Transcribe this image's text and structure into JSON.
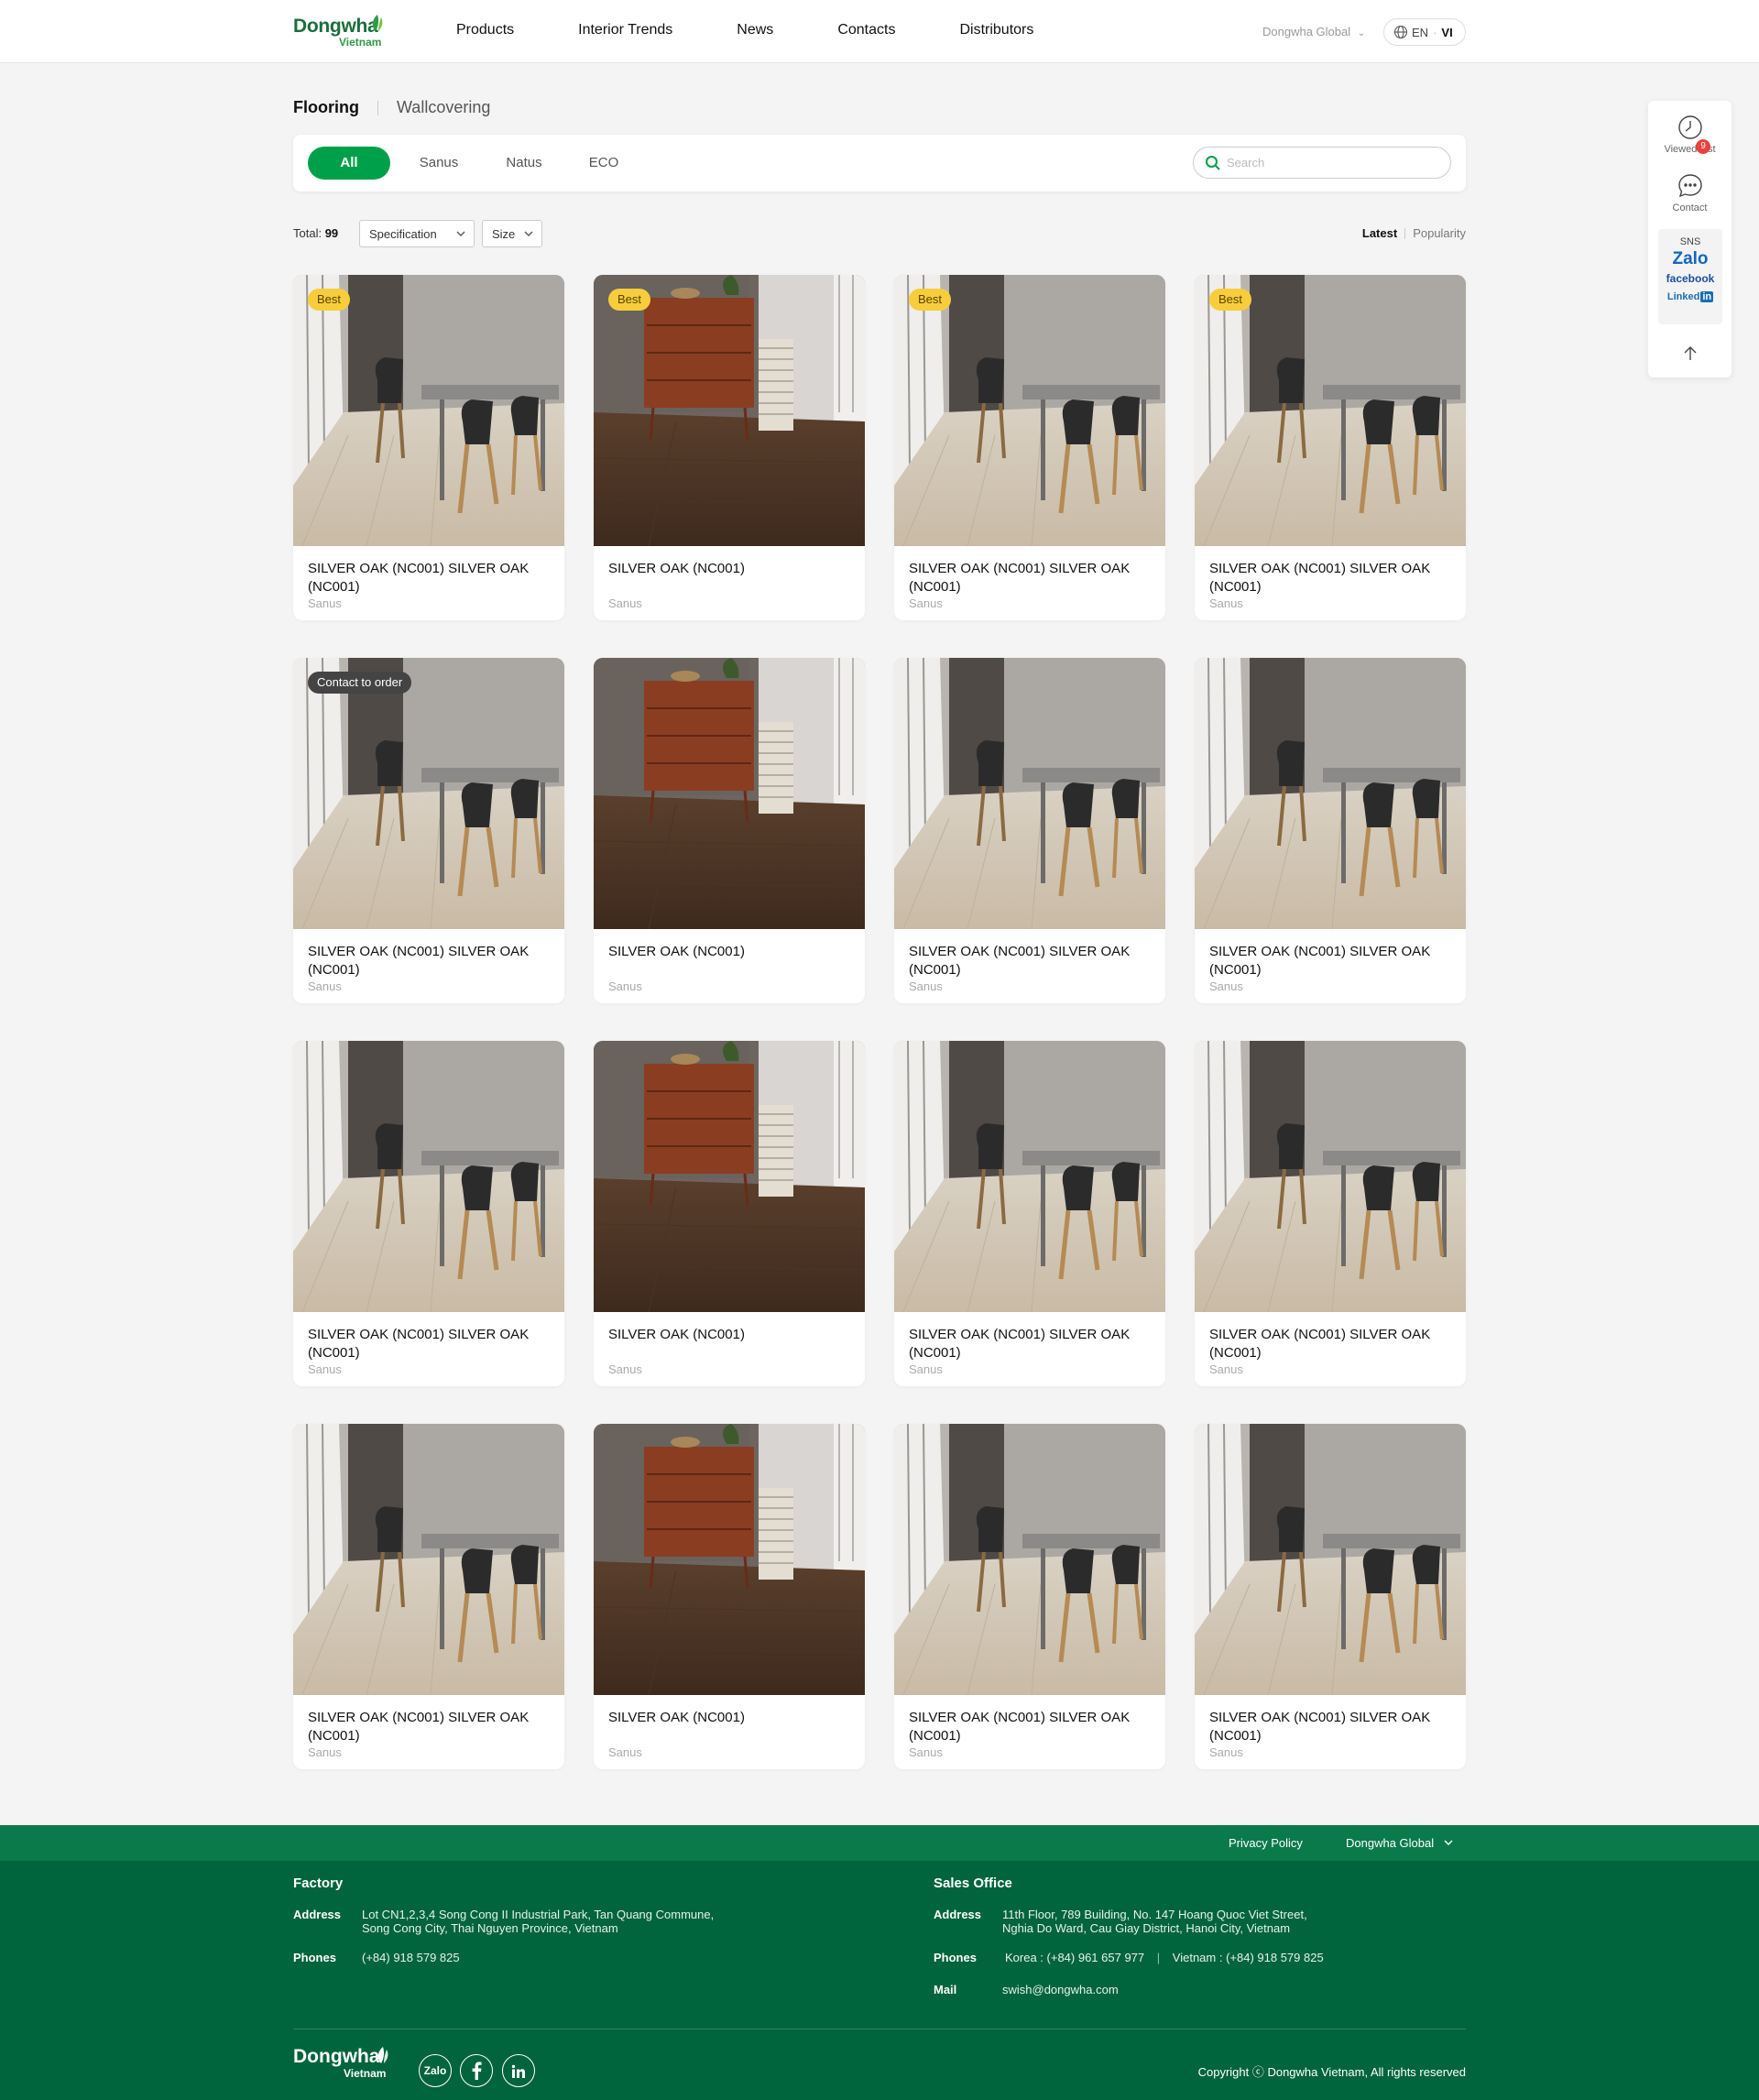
{
  "header": {
    "logo_word": "Dongwha",
    "logo_sub": "Vietnam",
    "nav": [
      "Products",
      "Interior Trends",
      "News",
      "Contacts",
      "Distributors"
    ],
    "global_label": "Dongwha Global",
    "lang_en": "EN",
    "lang_vi": "VI"
  },
  "category_tabs": {
    "active": "Flooring",
    "inactive": "Wallcovering"
  },
  "filters": {
    "pills": [
      "All",
      "Sanus",
      "Natus",
      "ECO"
    ],
    "search_placeholder": "Search"
  },
  "toolbar": {
    "total_label": "Total:",
    "total_count": "99",
    "spec_label": "Specification",
    "size_label": "Size",
    "sort_latest": "Latest",
    "sort_popularity": "Popularity"
  },
  "products": [
    {
      "name": "SILVER OAK (NC001) SILVER OAK (NC001)",
      "series": "Sanus",
      "badge": "Best",
      "badge_type": "best",
      "image": "dining"
    },
    {
      "name": "SILVER OAK (NC001)",
      "series": "Sanus",
      "badge": "Best",
      "badge_type": "best",
      "image": "cabinet"
    },
    {
      "name": "SILVER OAK (NC001) SILVER OAK (NC001)",
      "series": "Sanus",
      "badge": "Best",
      "badge_type": "best",
      "image": "dining"
    },
    {
      "name": "SILVER OAK (NC001) SILVER OAK (NC001)",
      "series": "Sanus",
      "badge": "Best",
      "badge_type": "best",
      "image": "dining"
    },
    {
      "name": "SILVER OAK (NC001) SILVER OAK (NC001)",
      "series": "Sanus",
      "badge": "Contact to order",
      "badge_type": "contact",
      "image": "dining"
    },
    {
      "name": "SILVER OAK (NC001)",
      "series": "Sanus",
      "badge": "",
      "badge_type": "",
      "image": "cabinet"
    },
    {
      "name": "SILVER OAK (NC001) SILVER OAK (NC001)",
      "series": "Sanus",
      "badge": "",
      "badge_type": "",
      "image": "dining"
    },
    {
      "name": "SILVER OAK (NC001) SILVER OAK (NC001)",
      "series": "Sanus",
      "badge": "",
      "badge_type": "",
      "image": "dining"
    },
    {
      "name": "SILVER OAK (NC001) SILVER OAK (NC001)",
      "series": "Sanus",
      "badge": "",
      "badge_type": "",
      "image": "dining"
    },
    {
      "name": "SILVER OAK (NC001)",
      "series": "Sanus",
      "badge": "",
      "badge_type": "",
      "image": "cabinet"
    },
    {
      "name": "SILVER OAK (NC001) SILVER OAK (NC001)",
      "series": "Sanus",
      "badge": "",
      "badge_type": "",
      "image": "dining"
    },
    {
      "name": "SILVER OAK (NC001) SILVER OAK (NC001)",
      "series": "Sanus",
      "badge": "",
      "badge_type": "",
      "image": "dining"
    },
    {
      "name": "SILVER OAK (NC001) SILVER OAK (NC001)",
      "series": "Sanus",
      "badge": "",
      "badge_type": "",
      "image": "dining"
    },
    {
      "name": "SILVER OAK (NC001)",
      "series": "Sanus",
      "badge": "",
      "badge_type": "",
      "image": "cabinet"
    },
    {
      "name": "SILVER OAK (NC001) SILVER OAK (NC001)",
      "series": "Sanus",
      "badge": "",
      "badge_type": "",
      "image": "dining"
    },
    {
      "name": "SILVER OAK (NC001) SILVER OAK (NC001)",
      "series": "Sanus",
      "badge": "",
      "badge_type": "",
      "image": "dining"
    }
  ],
  "side_widget": {
    "viewed_label": "Viewed List",
    "viewed_count": "9",
    "contact_label": "Contact",
    "sns_label": "SNS",
    "zalo": "Zalo",
    "facebook": "facebook",
    "linkedin": "Linked",
    "linkedin_in": "in"
  },
  "footer": {
    "privacy": "Privacy Policy",
    "global": "Dongwha Global",
    "factory_title": "Factory",
    "factory_address_label": "Address",
    "factory_address_1": "Lot CN1,2,3,4 Song Cong II Industrial Park, Tan Quang Commune,",
    "factory_address_2": "Song Cong City, Thai Nguyen Province, Vietnam",
    "factory_phones_label": "Phones",
    "factory_phones": "(+84) 918 579 825",
    "sales_title": "Sales Office",
    "sales_address_label": "Address",
    "sales_address_1": "11th Floor, 789 Building, No. 147 Hoang Quoc Viet Street,",
    "sales_address_2": "Nghia Do Ward, Cau Giay District, Hanoi City, Vietnam",
    "sales_phones_label": "Phones",
    "sales_phones_korea": "Korea : (+84) 961 657 977",
    "sales_phones_vietnam": "Vietnam : (+84) 918 579 825",
    "mail_label": "Mail",
    "mail": "swish@dongwha.com",
    "logo_word": "Dongwha",
    "logo_sub": "Vietnam",
    "social_zalo": "Zalo",
    "copyright": "Copyright ⓒ Dongwha Vietnam, All rights reserved"
  },
  "colors": {
    "brand_green": "#00a04a",
    "footer_green": "#00643c",
    "footer_top_green": "#0b7a4b",
    "best_badge": "#f7cd3c"
  }
}
